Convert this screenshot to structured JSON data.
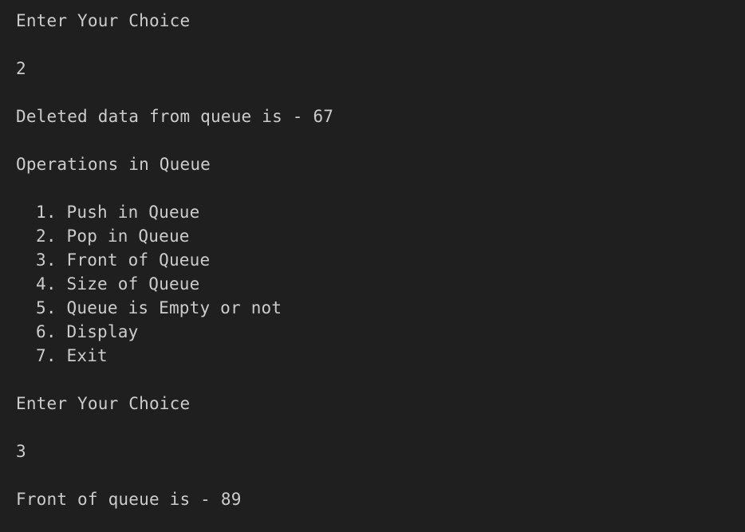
{
  "terminal": {
    "prompt1": "Enter Your Choice",
    "input1": "2",
    "deleted_line": "Deleted data from queue is - 67",
    "menu_title": "Operations in Queue",
    "menu_items": [
      "1. Push in Queue",
      "2. Pop in Queue",
      "3. Front of Queue",
      "4. Size of Queue",
      "5. Queue is Empty or not",
      "6. Display",
      "7. Exit"
    ],
    "prompt2": "Enter Your Choice",
    "input2": "3",
    "front_line": "Front of queue is - 89"
  },
  "colors": {
    "background": "#1f1f1f",
    "text": "#cccccc"
  }
}
